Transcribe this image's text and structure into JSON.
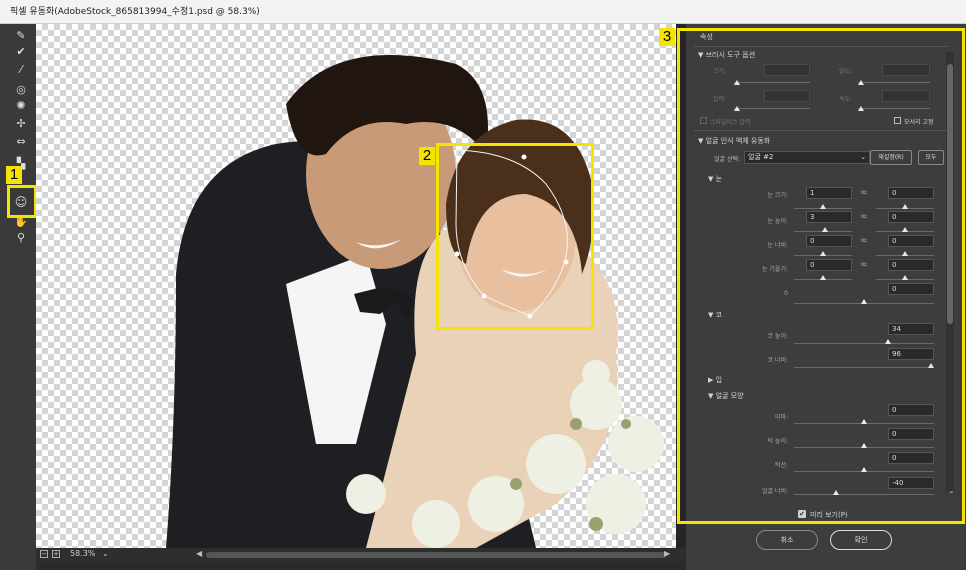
{
  "window": {
    "title": "픽셀 유동화(AdobeStock_865813994_수정1.psd @ 58.3%)"
  },
  "status": {
    "zoom": "58.3%"
  },
  "annotations": [
    "1",
    "2",
    "3"
  ],
  "panel": {
    "title": "속성",
    "brush_section": "브러시 도구 옵션",
    "brush": {
      "size_label": "크기:",
      "density_label": "밀도:",
      "pressure_label": "압력:",
      "rate_label": "속도:",
      "stylus_label": "스타일러스 압력",
      "pin_label": "모서리 고정"
    },
    "face_section": "얼굴 인식 액체 유동화",
    "face_select_label": "얼굴 선택:",
    "face_select_value": "얼굴 #2",
    "reset_label": "재설정(R)",
    "all_label": "모두",
    "eyes": {
      "title": "눈",
      "size": "눈 크기:",
      "height": "눈 높이:",
      "width": "눈 너비:",
      "tilt": "눈 기울기:",
      "distance": "0",
      "size_l": "1",
      "size_r": "0",
      "height_l": "3",
      "height_r": "0",
      "width_l": "0",
      "width_r": "0",
      "tilt_l": "0",
      "tilt_r": "0"
    },
    "nose": {
      "title": "코",
      "height": "코 높이:",
      "width": "코 너비:",
      "height_v": "34",
      "width_v": "96"
    },
    "mouth": {
      "title": "입"
    },
    "shape": {
      "title": "얼굴 모양",
      "forehead": "이마:",
      "chin_height": "턱 높이:",
      "jaw": "턱선:",
      "face_width": "얼굴 너비:",
      "forehead_v": "0",
      "chin_height_v": "0",
      "jaw_v": "0",
      "face_width_v": "-40"
    },
    "preview_label": "미리 보기(P)",
    "cancel": "취소",
    "ok": "확인"
  }
}
